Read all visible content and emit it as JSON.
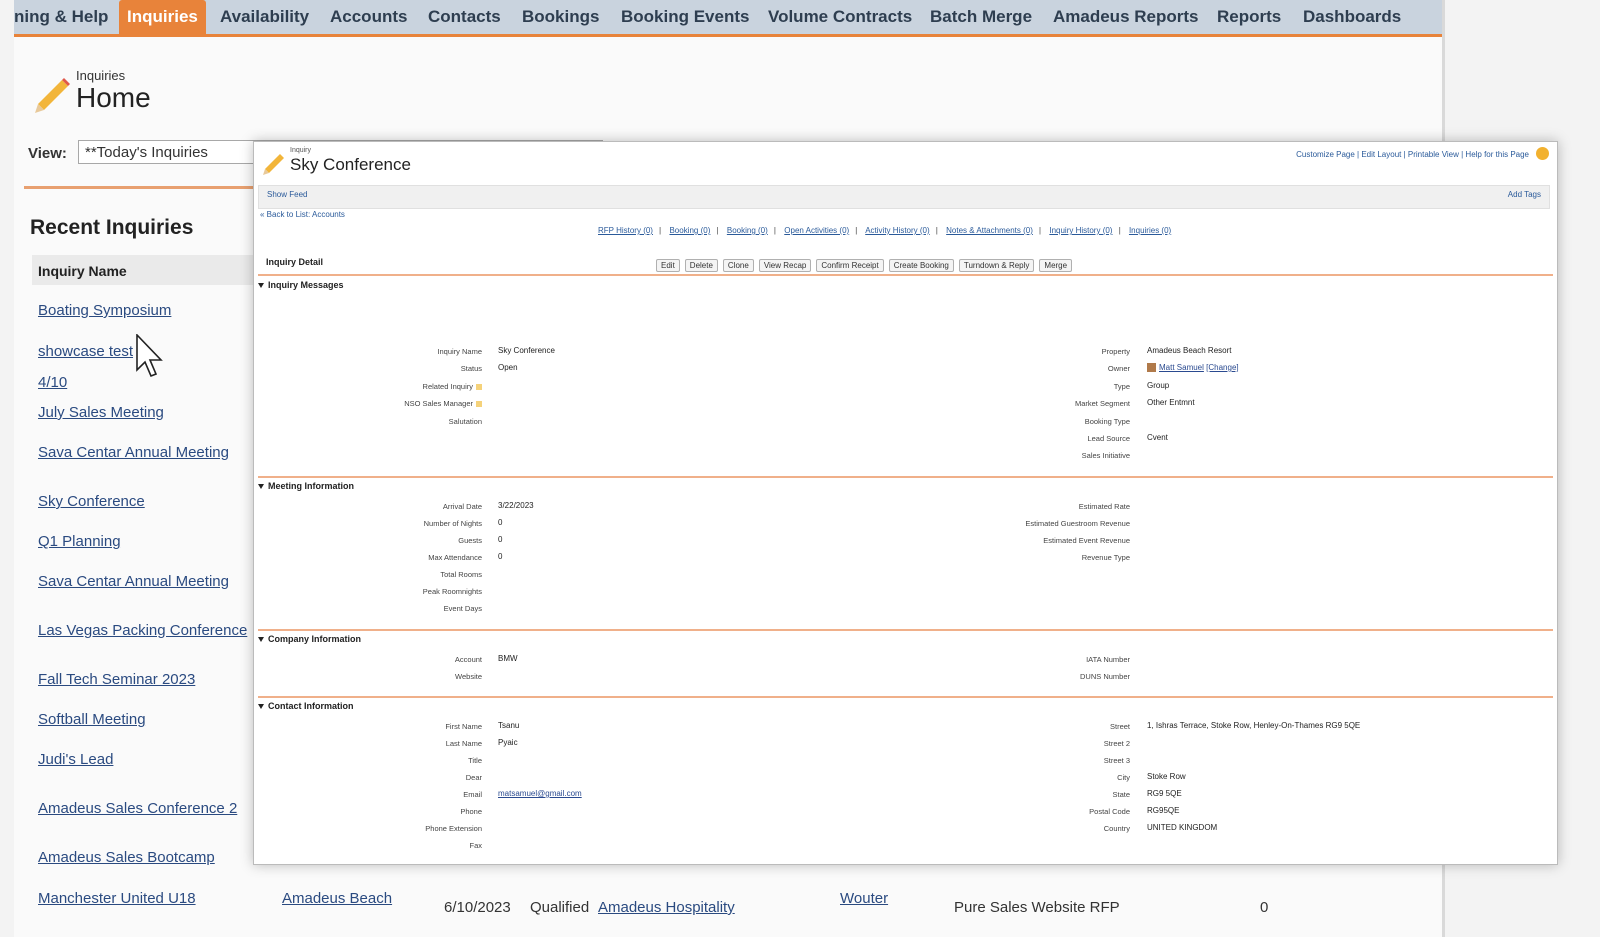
{
  "tabs": [
    {
      "label": "ning & Help",
      "active": false
    },
    {
      "label": "Inquiries",
      "active": true
    },
    {
      "label": "Availability",
      "active": false
    },
    {
      "label": "Accounts",
      "active": false
    },
    {
      "label": "Contacts",
      "active": false
    },
    {
      "label": "Bookings",
      "active": false
    },
    {
      "label": "Booking Events",
      "active": false
    },
    {
      "label": "Volume Contracts",
      "active": false
    },
    {
      "label": "Batch Merge",
      "active": false
    },
    {
      "label": "Amadeus Reports",
      "active": false
    },
    {
      "label": "Reports",
      "active": false
    },
    {
      "label": "Dashboards",
      "active": false
    }
  ],
  "home": {
    "super": "Inquiries",
    "title": "Home",
    "view_label": "View:",
    "view_value": "**Today's Inquiries"
  },
  "recent": {
    "title": "Recent Inquiries",
    "column_header": "Inquiry Name",
    "items": [
      "Boating Symposium",
      "showcase test",
      "4/10",
      "July Sales Meeting",
      "Sava Centar Annual Meeting",
      "Sky Conference",
      "Q1 Planning",
      "Sava Centar Annual Meeting",
      "Las Vegas Packing Conference",
      "Fall Tech Seminar 2023",
      "Softball Meeting",
      "Judi's Lead",
      "Amadeus Sales Conference 2",
      "Amadeus Sales Bootcamp",
      "Manchester United U18"
    ],
    "bottom_row": {
      "property": "Amadeus Beach",
      "date": "6/10/2023",
      "status": "Qualified",
      "account": "Amadeus Hospitality",
      "owner": "Wouter",
      "source": "Pure Sales Website RFP",
      "count": "0"
    }
  },
  "detail": {
    "super": "Inquiry",
    "title": "Sky Conference",
    "top_links": "Customize Page | Edit Layout | Printable View | Help for this Page",
    "show_feed": "Show Feed",
    "add_tags": "Add Tags",
    "back_link": "« Back to List: Accounts",
    "related_lists": [
      "RFP History (0)",
      "Booking (0)",
      "Booking (0)",
      "Open Activities (0)",
      "Activity History (0)",
      "Notes & Attachments (0)",
      "Inquiry History (0)",
      "Inquiries (0)"
    ],
    "detail_title": "Inquiry Detail",
    "buttons": [
      "Edit",
      "Delete",
      "Clone",
      "View Recap",
      "Confirm Receipt",
      "Create Booking",
      "Turndown & Reply",
      "Merge"
    ],
    "sections": {
      "messages": "Inquiry Messages",
      "meeting": "Meeting Information",
      "company": "Company Information",
      "contact": "Contact Information"
    },
    "fields": {
      "inquiry_name": {
        "label": "Inquiry Name",
        "value": "Sky Conference"
      },
      "status": {
        "label": "Status",
        "value": "Open"
      },
      "related_inquiry": {
        "label": "Related Inquiry",
        "value": ""
      },
      "nso_sales_manager": {
        "label": "NSO Sales Manager",
        "value": ""
      },
      "salutation": {
        "label": "Salutation",
        "value": ""
      },
      "property": {
        "label": "Property",
        "value": "Amadeus Beach Resort"
      },
      "owner": {
        "label": "Owner",
        "value": "Matt Samuel",
        "change": "[Change]"
      },
      "type": {
        "label": "Type",
        "value": "Group"
      },
      "market_segment": {
        "label": "Market Segment",
        "value": "Other Entmnt"
      },
      "booking_type": {
        "label": "Booking Type",
        "value": ""
      },
      "lead_source": {
        "label": "Lead Source",
        "value": "Cvent"
      },
      "sales_initiative": {
        "label": "Sales Initiative",
        "value": ""
      },
      "arrival_date": {
        "label": "Arrival Date",
        "value": "3/22/2023"
      },
      "nights": {
        "label": "Number of Nights",
        "value": "0"
      },
      "guests": {
        "label": "Guests",
        "value": "0"
      },
      "max_attendance": {
        "label": "Max Attendance",
        "value": "0"
      },
      "total_rooms": {
        "label": "Total Rooms",
        "value": ""
      },
      "peak_roomnights": {
        "label": "Peak Roomnights",
        "value": ""
      },
      "event_days": {
        "label": "Event Days",
        "value": ""
      },
      "estimated_rate": {
        "label": "Estimated Rate",
        "value": ""
      },
      "est_guestroom_rev": {
        "label": "Estimated Guestroom Revenue",
        "value": ""
      },
      "est_event_rev": {
        "label": "Estimated Event Revenue",
        "value": ""
      },
      "revenue_type": {
        "label": "Revenue Type",
        "value": ""
      },
      "account": {
        "label": "Account",
        "value": "BMW"
      },
      "website": {
        "label": "Website",
        "value": ""
      },
      "iata": {
        "label": "IATA Number",
        "value": ""
      },
      "duns": {
        "label": "DUNS Number",
        "value": ""
      },
      "first_name": {
        "label": "First Name",
        "value": "Tsanu"
      },
      "last_name": {
        "label": "Last Name",
        "value": "Pyaic"
      },
      "title": {
        "label": "Title",
        "value": ""
      },
      "dear": {
        "label": "Dear",
        "value": ""
      },
      "email": {
        "label": "Email",
        "value": "matsamuel@gmail.com"
      },
      "phone": {
        "label": "Phone",
        "value": ""
      },
      "phone_ext": {
        "label": "Phone Extension",
        "value": ""
      },
      "fax": {
        "label": "Fax",
        "value": ""
      },
      "street": {
        "label": "Street",
        "value": "1, Ishras Terrace, Stoke Row, Henley-On-Thames RG9 5QE"
      },
      "street2": {
        "label": "Street 2",
        "value": ""
      },
      "street3": {
        "label": "Street 3",
        "value": ""
      },
      "city": {
        "label": "City",
        "value": "Stoke Row"
      },
      "state": {
        "label": "State",
        "value": "RG9 5QE"
      },
      "postal": {
        "label": "Postal Code",
        "value": "RG95QE"
      },
      "country": {
        "label": "Country",
        "value": "UNITED KINGDOM"
      }
    }
  },
  "colors": {
    "accent": "#e8833a",
    "tabbar": "#c9d3de",
    "link": "#2a4a80"
  }
}
